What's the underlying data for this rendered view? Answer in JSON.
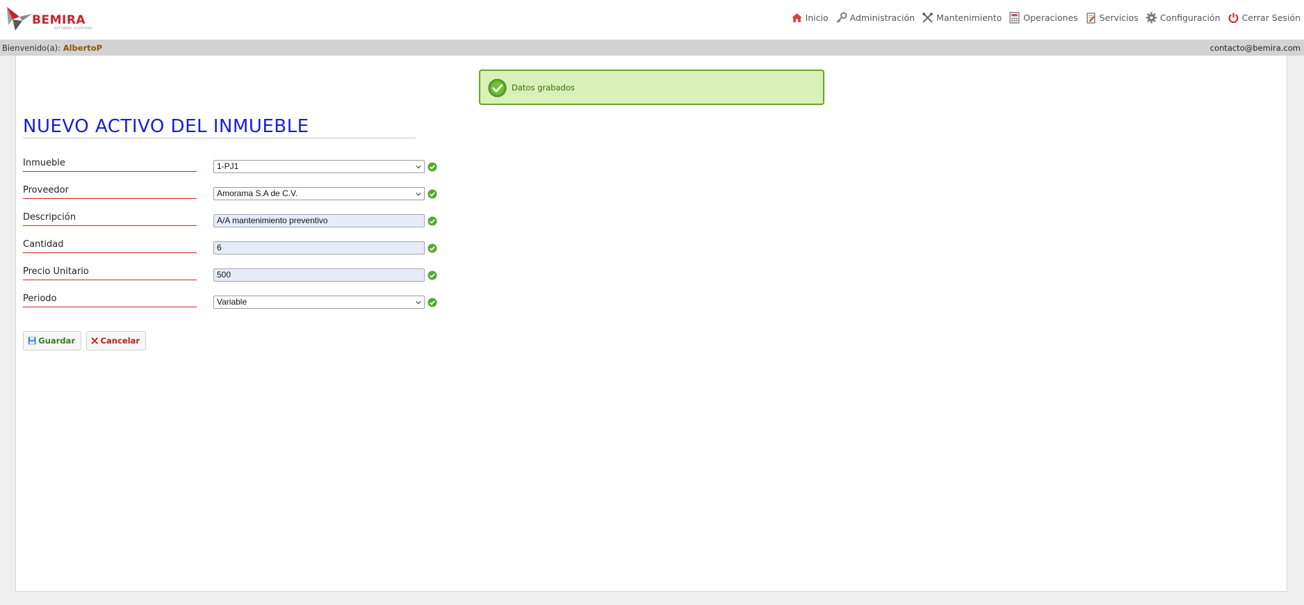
{
  "header": {
    "logo_text": "BEMIRA",
    "logo_subtext": "SOFTWARE SOLUTIONS",
    "nav": [
      {
        "label": "Inicio",
        "icon": "home-icon"
      },
      {
        "label": "Administración",
        "icon": "key-icon"
      },
      {
        "label": "Mantenimiento",
        "icon": "tools-icon"
      },
      {
        "label": "Operaciones",
        "icon": "calculator-icon"
      },
      {
        "label": "Servicios",
        "icon": "clipboard-icon"
      },
      {
        "label": "Configuración",
        "icon": "gear-icon"
      },
      {
        "label": "Cerrar Sesión",
        "icon": "power-icon"
      }
    ]
  },
  "welcome": {
    "prefix": "Bienvenido(a):",
    "user": "AlbertoP",
    "contact": "contacto@bemira.com"
  },
  "alert": {
    "message": "Datos grabados"
  },
  "form": {
    "title": "NUEVO ACTIVO DEL INMUEBLE",
    "fields": [
      {
        "label": "Inmueble",
        "value": "1-PJ1",
        "type": "select"
      },
      {
        "label": "Proveedor",
        "value": "Amorama S.A de C.V.",
        "type": "select"
      },
      {
        "label": "Descripción",
        "value": "A/A mantenimiento preventivo",
        "type": "text"
      },
      {
        "label": "Cantidad",
        "value": "6",
        "type": "text"
      },
      {
        "label": "Precio Unitario",
        "value": "500",
        "type": "text"
      },
      {
        "label": "Periodo",
        "value": "Variable",
        "type": "select"
      }
    ],
    "buttons": {
      "save": "Guardar",
      "cancel": "Cancelar"
    }
  },
  "colors": {
    "brand": "#c0262d",
    "title": "#1a1ae0",
    "alert_bg": "#d9f0b8",
    "alert_border": "#6aa22c",
    "label_underline": "#d62020"
  }
}
